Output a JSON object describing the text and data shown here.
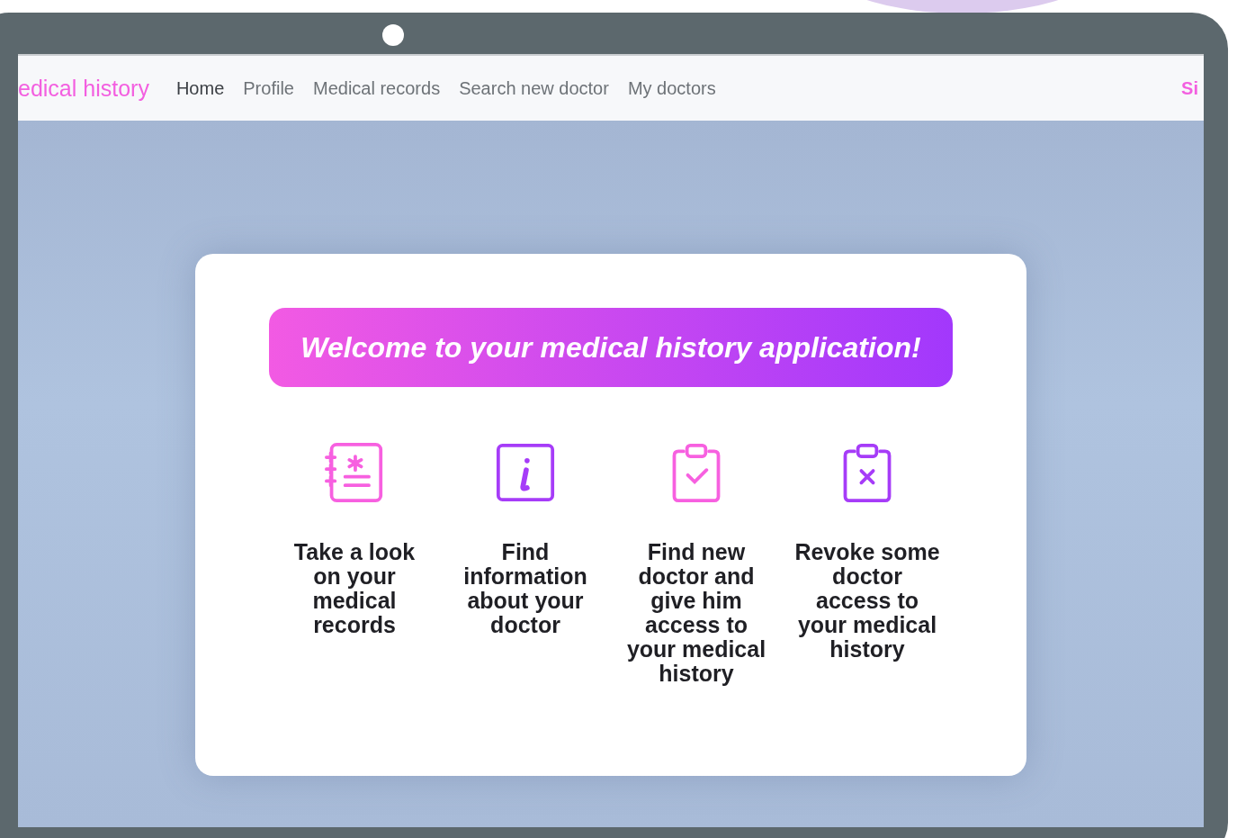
{
  "navbar": {
    "brand": "edical history",
    "links": [
      {
        "label": "Home",
        "selected": true
      },
      {
        "label": "Profile",
        "selected": false
      },
      {
        "label": "Medical records",
        "selected": false
      },
      {
        "label": "Search new doctor",
        "selected": false
      },
      {
        "label": "My doctors",
        "selected": false
      }
    ],
    "right_link": "Si"
  },
  "banner": {
    "title": "Welcome to your medical history application!"
  },
  "features": [
    {
      "kind": "records",
      "color": "#f760e0",
      "label": "Take a look on your medical records"
    },
    {
      "kind": "info",
      "color": "#a63cf8",
      "label": "Find information about your doctor"
    },
    {
      "kind": "check",
      "color": "#f760e0",
      "label": "Find new doctor and give him access to your medical history"
    },
    {
      "kind": "revoke",
      "color": "#a63cf8",
      "label": "Revoke some doctor access to your medical history"
    }
  ]
}
